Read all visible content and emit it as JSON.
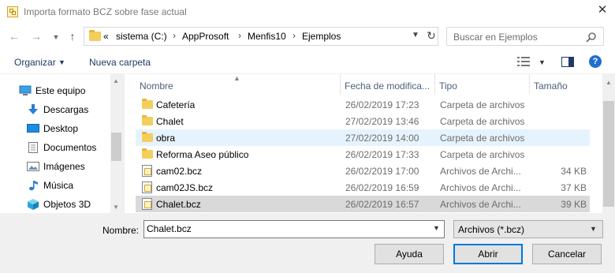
{
  "window": {
    "title": "Importa formato BCZ sobre fase actual",
    "close_glyph": "✕"
  },
  "address_bar": {
    "overflow_glyph": "«",
    "crumbs": [
      "sistema (C:)",
      "AppProsoft",
      "Menfis10",
      "Ejemplos"
    ],
    "separator": "›",
    "search_placeholder": "Buscar en Ejemplos"
  },
  "toolbar": {
    "organizar_label": "Organizar",
    "nueva_carpeta_label": "Nueva carpeta"
  },
  "nav_pane": {
    "items": [
      {
        "label": "Este equipo",
        "icon": "computer-icon"
      },
      {
        "label": "Descargas",
        "icon": "downloads-icon"
      },
      {
        "label": "Desktop",
        "icon": "desktop-icon"
      },
      {
        "label": "Documentos",
        "icon": "documents-icon"
      },
      {
        "label": "Imágenes",
        "icon": "pictures-icon"
      },
      {
        "label": "Música",
        "icon": "music-icon"
      },
      {
        "label": "Objetos 3D",
        "icon": "3d-objects-icon"
      }
    ]
  },
  "file_list": {
    "columns": [
      "Nombre",
      "Fecha de modifica...",
      "Tipo",
      "Tamaño"
    ],
    "sort_column": "Nombre",
    "rows": [
      {
        "name": "Cafetería",
        "date": "26/02/2019 17:23",
        "type": "Carpeta de archivos",
        "size": "",
        "kind": "folder",
        "state": ""
      },
      {
        "name": "Chalet",
        "date": "27/02/2019 13:46",
        "type": "Carpeta de archivos",
        "size": "",
        "kind": "folder",
        "state": ""
      },
      {
        "name": "obra",
        "date": "27/02/2019 14:00",
        "type": "Carpeta de archivos",
        "size": "",
        "kind": "folder",
        "state": "hover"
      },
      {
        "name": "Reforma Aseo público",
        "date": "26/02/2019 17:33",
        "type": "Carpeta de archivos",
        "size": "",
        "kind": "folder",
        "state": ""
      },
      {
        "name": "cam02.bcz",
        "date": "26/02/2019 17:00",
        "type": "Archivos de Archi...",
        "size": "34 KB",
        "kind": "file",
        "state": ""
      },
      {
        "name": "cam02JS.bcz",
        "date": "26/02/2019 16:59",
        "type": "Archivos de Archi...",
        "size": "37 KB",
        "kind": "file",
        "state": ""
      },
      {
        "name": "Chalet.bcz",
        "date": "26/02/2019 16:57",
        "type": "Archivos de Archi...",
        "size": "39 KB",
        "kind": "file",
        "state": "selected"
      }
    ]
  },
  "footer": {
    "nombre_label": "Nombre:",
    "nombre_value": "Chalet.bcz",
    "filter_value": "Archivos (*.bcz)",
    "buttons": {
      "ayuda": "Ayuda",
      "abrir": "Abrir",
      "cancelar": "Cancelar"
    }
  },
  "colors": {
    "hover_row": "#e5f3ff",
    "selected_row": "#d9d9d9",
    "header_text": "#4c607a",
    "link_text": "#1e3a64",
    "accent": "#0078d7"
  }
}
